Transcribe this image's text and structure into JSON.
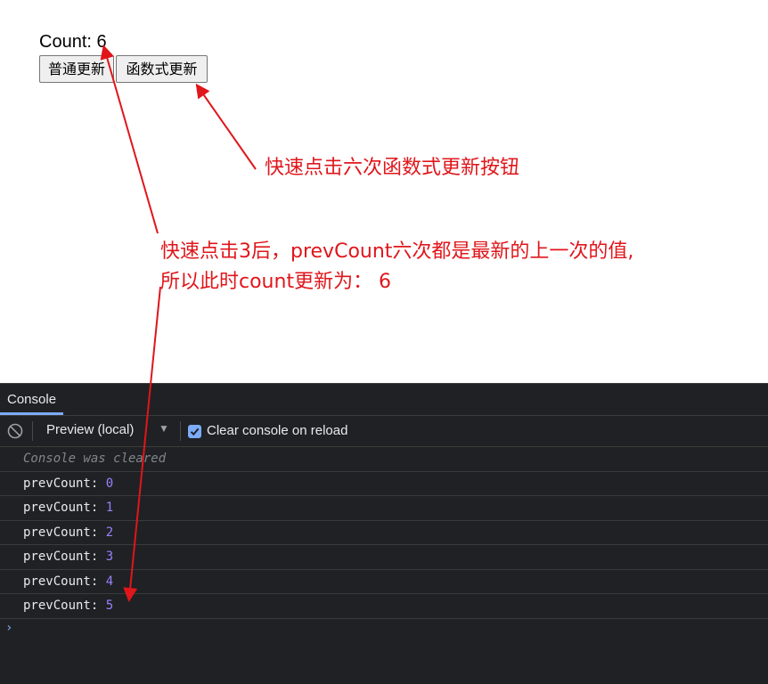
{
  "app": {
    "count_text": "Count: 6",
    "buttons": {
      "normal_update": "普通更新",
      "functional_update": "函数式更新"
    }
  },
  "annotations": {
    "click_six_times": "快速点击六次函数式更新按钮",
    "explain_line1": "快速点击3后，prevCount六次都是最新的上一次的值,",
    "explain_line2": "所以此时count更新为： 6",
    "color": "#e0161b"
  },
  "devtools": {
    "tab_label": "Console",
    "toolbar": {
      "clear_icon": "no-entry-icon",
      "context": "Preview (local)",
      "clear_on_reload_label": "Clear console on reload",
      "clear_on_reload_checked": true
    },
    "cleared_message": "Console was cleared",
    "logs": [
      {
        "label": "prevCount: ",
        "value": "0"
      },
      {
        "label": "prevCount: ",
        "value": "1"
      },
      {
        "label": "prevCount: ",
        "value": "2"
      },
      {
        "label": "prevCount: ",
        "value": "3"
      },
      {
        "label": "prevCount: ",
        "value": "4"
      },
      {
        "label": "prevCount: ",
        "value": "5"
      }
    ],
    "prompt_symbol": "›",
    "colors": {
      "background": "#202124",
      "number": "#9980ff",
      "accent": "#7cacf8"
    }
  }
}
